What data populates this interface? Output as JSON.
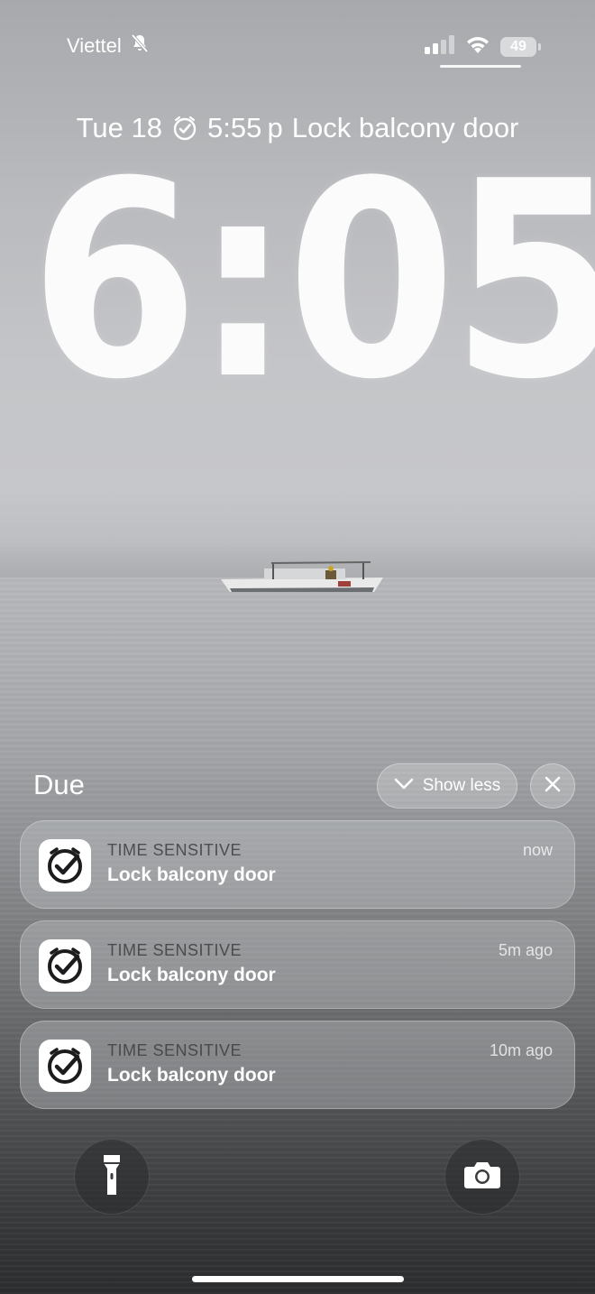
{
  "status_bar": {
    "carrier": "Viettel",
    "battery_level": "49"
  },
  "lock_screen": {
    "date": "Tue 18",
    "alarm_time": "5:55 p",
    "alarm_label": "Lock balcony door",
    "time": "6:05"
  },
  "notification_group": {
    "header": "Due",
    "show_less_label": "Show less"
  },
  "notifications": [
    {
      "kind": "TIME SENSITIVE",
      "title": "Lock balcony door",
      "time": "now"
    },
    {
      "kind": "TIME SENSITIVE",
      "title": "Lock balcony door",
      "time": "5m ago"
    },
    {
      "kind": "TIME SENSITIVE",
      "title": "Lock balcony door",
      "time": "10m ago"
    }
  ],
  "icons": {
    "silent": "bell-slash-icon",
    "signal": "cellular-signal-icon",
    "wifi": "wifi-icon",
    "alarm": "alarm-check-icon",
    "chevron": "chevron-down-icon",
    "close": "close-icon",
    "app": "reminder-check-icon",
    "flashlight": "flashlight-icon",
    "camera": "camera-icon"
  }
}
